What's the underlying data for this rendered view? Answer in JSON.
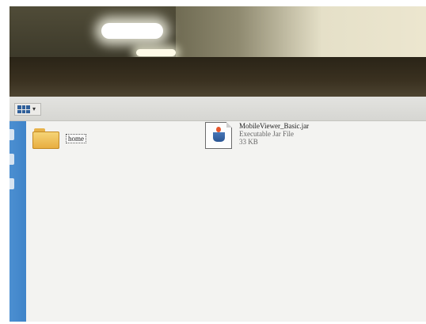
{
  "toolbar": {
    "view_button_icon": "icon-view-grid-icon"
  },
  "sidebar": {
    "tabs": 3
  },
  "files": [
    {
      "name": "home",
      "type": "folder",
      "icon": "folder-icon"
    },
    {
      "name": "MobileViewer_Basic.jar",
      "type": "Executable Jar File",
      "size": "33 KB",
      "icon": "java-jar-icon"
    }
  ]
}
